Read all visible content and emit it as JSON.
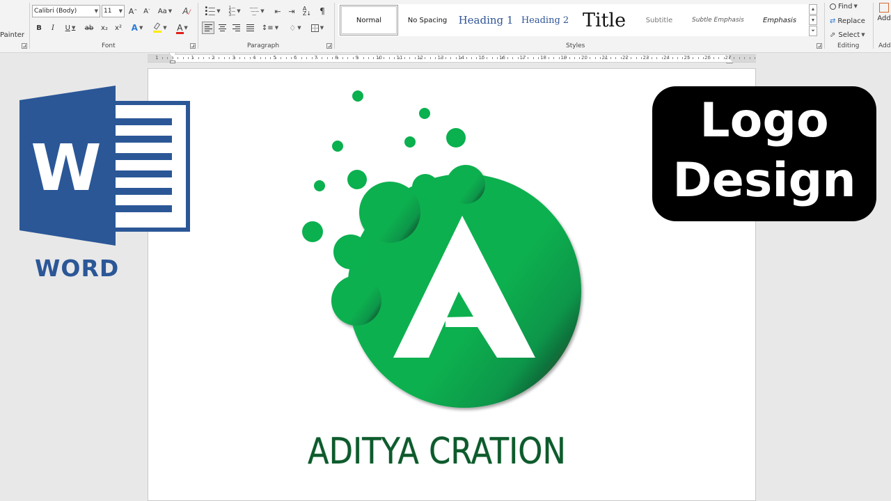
{
  "ribbon": {
    "clipboard": {
      "painter_label": "Painter"
    },
    "font": {
      "group_label": "Font",
      "family_value": "Calibri (Body)",
      "size_value": "11",
      "grow_label": "A^",
      "shrink_label": "Aˇ",
      "case_label": "Aa",
      "bold_label": "B",
      "italic_label": "I",
      "underline_label": "U",
      "strike_label": "ab",
      "subscript_label": "x₂",
      "superscript_label": "x²",
      "effects_label": "A",
      "color_label": "A"
    },
    "paragraph": {
      "group_label": "Paragraph",
      "pilcrow": "¶"
    },
    "styles": {
      "group_label": "Styles",
      "items": [
        {
          "label": "Normal"
        },
        {
          "label": "No Spacing"
        },
        {
          "label": "Heading 1"
        },
        {
          "label": "Heading 2"
        },
        {
          "label": "Title"
        },
        {
          "label": "Subtitle"
        },
        {
          "label": "Subtle Emphasis"
        },
        {
          "label": "Emphasis"
        }
      ]
    },
    "editing": {
      "group_label": "Editing",
      "find_label": "Find",
      "replace_label": "Replace",
      "select_label": "Select"
    },
    "addins": {
      "label": "Add",
      "group_label": "Add"
    }
  },
  "ruler": {
    "numbers": [
      "1",
      "1",
      "2",
      "3",
      "4",
      "5",
      "6",
      "7",
      "8",
      "9",
      "10",
      "11",
      "12",
      "13",
      "14",
      "15",
      "16",
      "17",
      "18",
      "19",
      "20",
      "21",
      "22",
      "23",
      "24",
      "25",
      "26",
      "27"
    ]
  },
  "document": {
    "brand_name": "ADITYA CRATION",
    "logo_colors": {
      "green": "#0bb04f",
      "dark_green": "#0e5a2c",
      "letter": "#ffffff"
    }
  },
  "overlay": {
    "word_icon_letter": "W",
    "word_label": "WORD",
    "badge_line1": "Logo",
    "badge_line2": "Design",
    "word_blue": "#2b5797"
  }
}
